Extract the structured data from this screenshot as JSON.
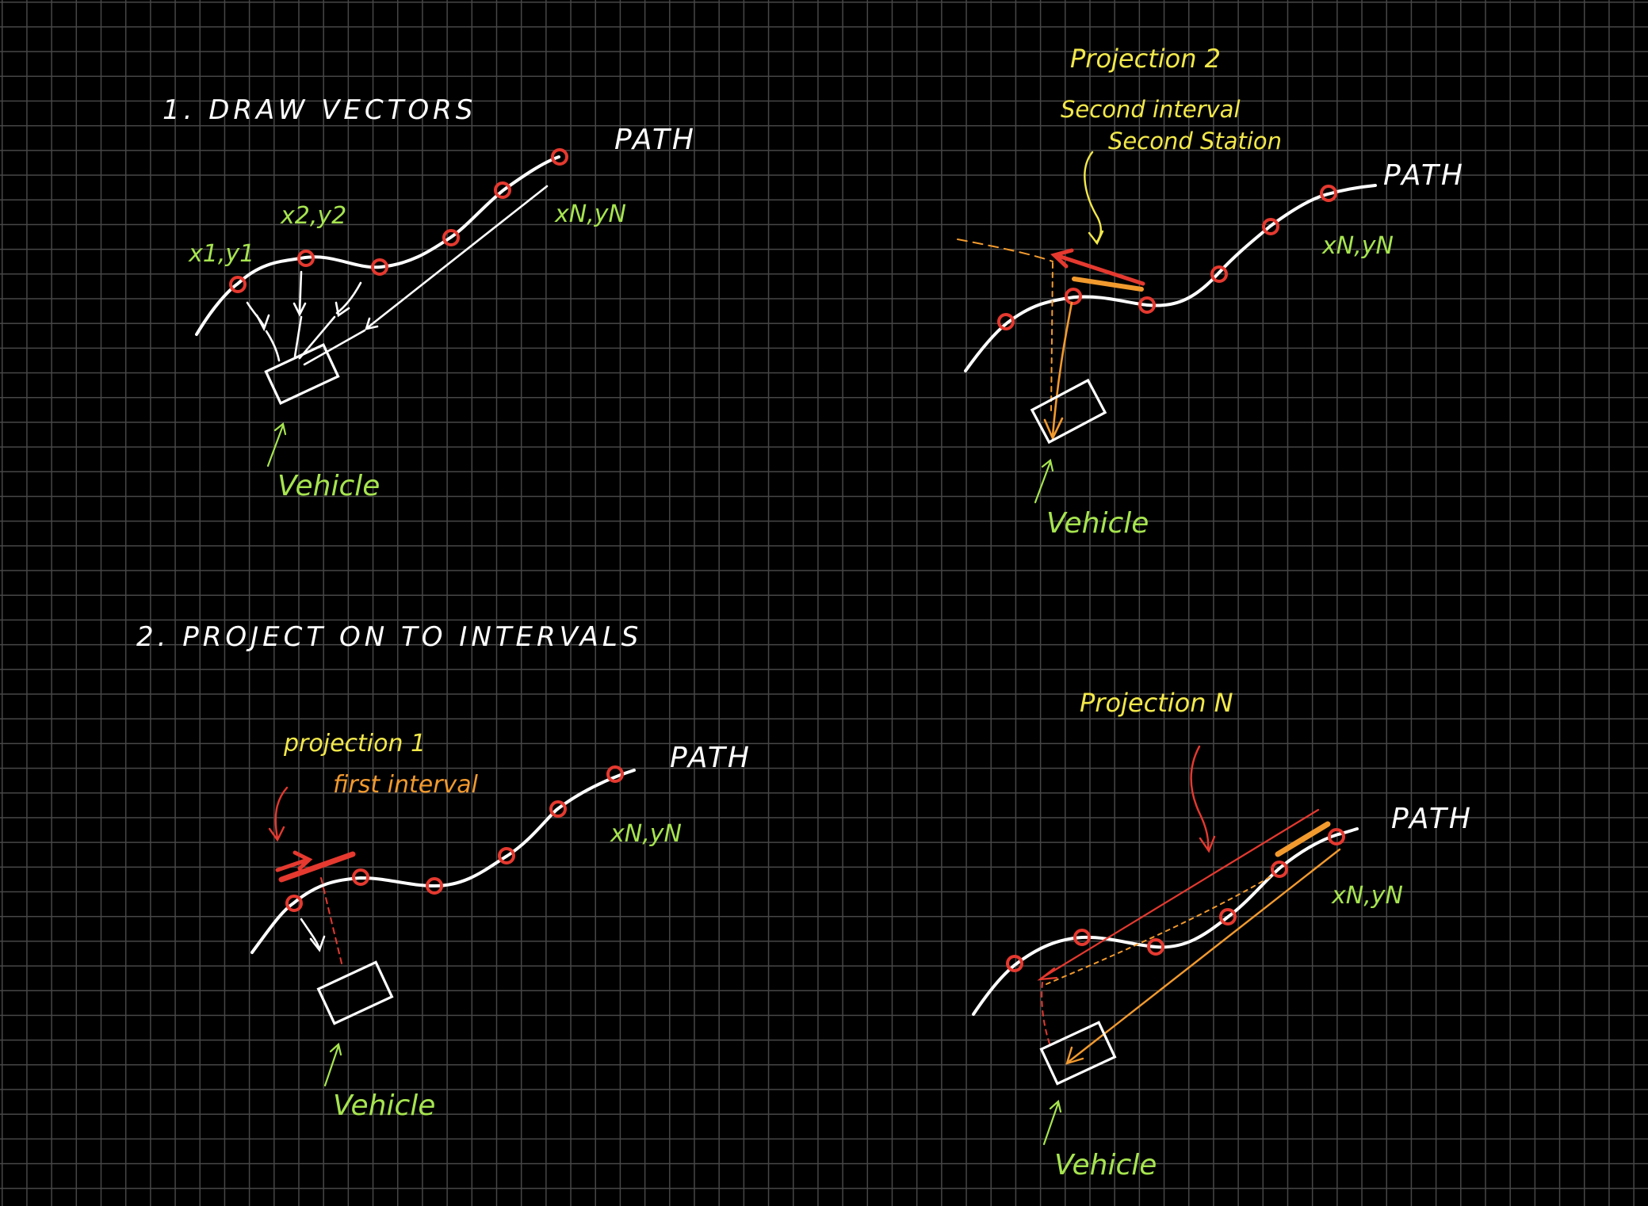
{
  "headings": {
    "draw_vectors": "1. DRAW VECTORS",
    "project_intervals": "2. PROJECT ON TO INTERVALS"
  },
  "panels": {
    "draw_vectors": {
      "path_label": "PATH",
      "point_1": "x1,y1",
      "point_2": "x2,y2",
      "point_n": "xN,yN",
      "vehicle_label": "Vehicle"
    },
    "projection_1": {
      "title": "projection 1",
      "subtitle": "first interval",
      "path_label": "PATH",
      "point_n": "xN,yN",
      "vehicle_label": "Vehicle"
    },
    "projection_2": {
      "title": "Projection 2",
      "subtitle_1": "Second interval",
      "subtitle_2": "Second Station",
      "path_label": "PATH",
      "point_n": "xN,yN",
      "vehicle_label": "Vehicle"
    },
    "projection_n": {
      "title": "Projection N",
      "path_label": "PATH",
      "point_n": "xN,yN",
      "vehicle_label": "Vehicle"
    }
  },
  "colors": {
    "background": "#000000",
    "grid": "#474747",
    "path": "#ffffff",
    "station": "#e5392f",
    "label_green": "#a6e44f",
    "label_yellow": "#f2e84a",
    "label_orange": "#f29a2e"
  }
}
